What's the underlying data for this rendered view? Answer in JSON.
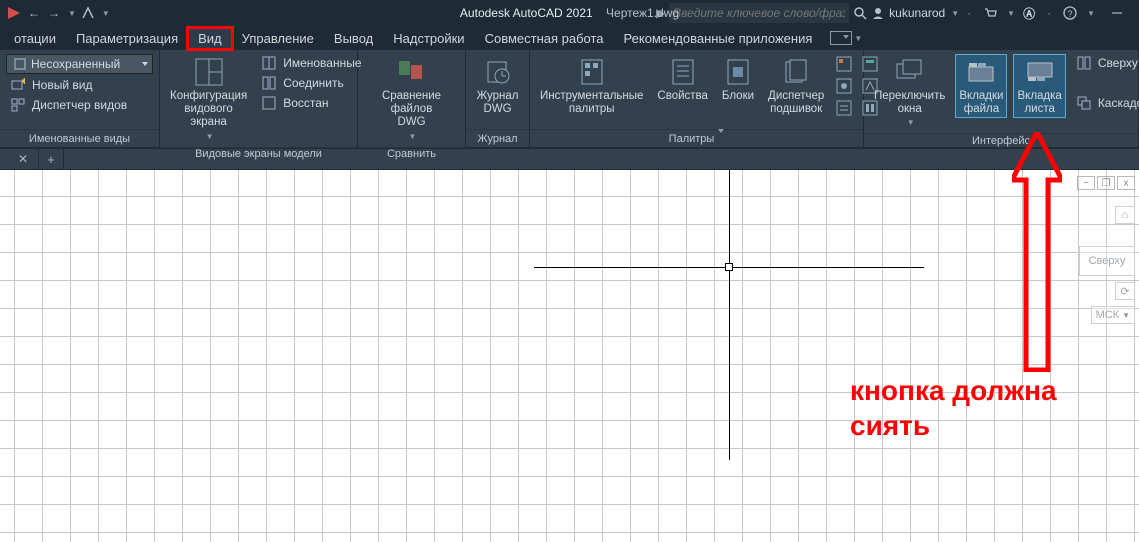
{
  "titlebar": {
    "app": "Autodesk AutoCAD 2021",
    "file": "Чертеж1.dwg",
    "search_placeholder": "Введите ключевое слово/фразу",
    "user": "kukunarod"
  },
  "menu": {
    "items": [
      "отации",
      "Параметризация",
      "Вид",
      "Управление",
      "Вывод",
      "Надстройки",
      "Совместная работа",
      "Рекомендованные приложения"
    ],
    "active_index": 2
  },
  "ribbon": {
    "p1": {
      "title": "Именованные виды",
      "layer_dd": "Несохраненный",
      "btn_newview": "Новый вид",
      "btn_viewmgr": "Диспетчер видов"
    },
    "p2": {
      "title": "Видовые экраны модели",
      "config_label": "Конфигурация\nвидового экрана",
      "btn_named": "Именованные",
      "btn_join": "Соединить",
      "btn_restore": "Восстан"
    },
    "p3": {
      "title": "Сравнить",
      "compare_label": "Сравнение файлов\nDWG"
    },
    "p4": {
      "title": "Журнал",
      "history_label": "Журнал\nDWG"
    },
    "p5": {
      "title": "Палитры",
      "tool_palettes": "Инструментальные\nпалитры",
      "props": "Свойства",
      "blocks": "Блоки",
      "sheetset": "Диспетчер\nподшивок"
    },
    "p6": {
      "title": "Интерфейс",
      "switchwin": "Переключить\nокна",
      "filetabs": "Вкладки\nфайла",
      "layouttabs": "Вкладка\nлиста",
      "topview": "Сверху вн",
      "cascade": "Каскадом"
    }
  },
  "viewcube": {
    "top": "Сверху",
    "wcs": "МСК"
  },
  "annotation": {
    "line1": "кнопка должна",
    "line2": "сиять"
  }
}
